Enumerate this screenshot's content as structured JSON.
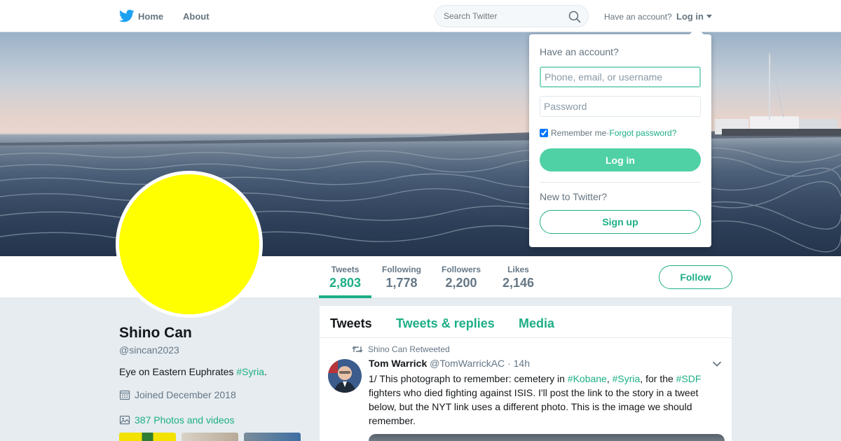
{
  "nav": {
    "home_label": "Home",
    "about_label": "About",
    "search_placeholder": "Search Twitter",
    "have_account": "Have an account?",
    "login_label": "Log in"
  },
  "profile": {
    "name": "Shino Can",
    "handle": "@sincan2023",
    "bio_text": "Eye on Eastern Euphrates ",
    "bio_tag": "#Syria",
    "bio_end": ".",
    "joined": "Joined December 2018",
    "photos": "387 Photos and videos",
    "avatar_color": "#ffff00"
  },
  "stats": [
    {
      "label": "Tweets",
      "value": "2,803",
      "active": true
    },
    {
      "label": "Following",
      "value": "1,778",
      "active": false
    },
    {
      "label": "Followers",
      "value": "2,200",
      "active": false
    },
    {
      "label": "Likes",
      "value": "2,146",
      "active": false
    }
  ],
  "follow_label": "Follow",
  "timeline": {
    "tabs": [
      "Tweets",
      "Tweets & replies",
      "Media"
    ],
    "tweet": {
      "retweeted_by": "Shino Can Retweeted",
      "author": "Tom Warrick",
      "handle": "@TomWarrickAC",
      "time": "14h",
      "text_1": "1/ This photograph to remember: cemetery in ",
      "tag_1": "#Kobane",
      "sep_1": ", ",
      "tag_2": "#Syria",
      "text_2": ", for the ",
      "tag_3": "#SDF",
      "text_3": " fighters who died fighting against ISIS. I'll post the link to the story in a tweet below, but the NYT link uses a different photo. This is the image we should remember."
    }
  },
  "login_dropdown": {
    "title": "Have an account?",
    "username_placeholder": "Phone, email, or username",
    "password_placeholder": "Password",
    "remember": "Remember me",
    "sep": " · ",
    "forgot": "Forgot password?",
    "login_button": "Log in",
    "new_to": "New to Twitter?",
    "signup_button": "Sign up"
  },
  "colors": {
    "accent": "#1dae86",
    "login_button": "#4fd1a5",
    "twitter_blue": "#1da1f2"
  }
}
